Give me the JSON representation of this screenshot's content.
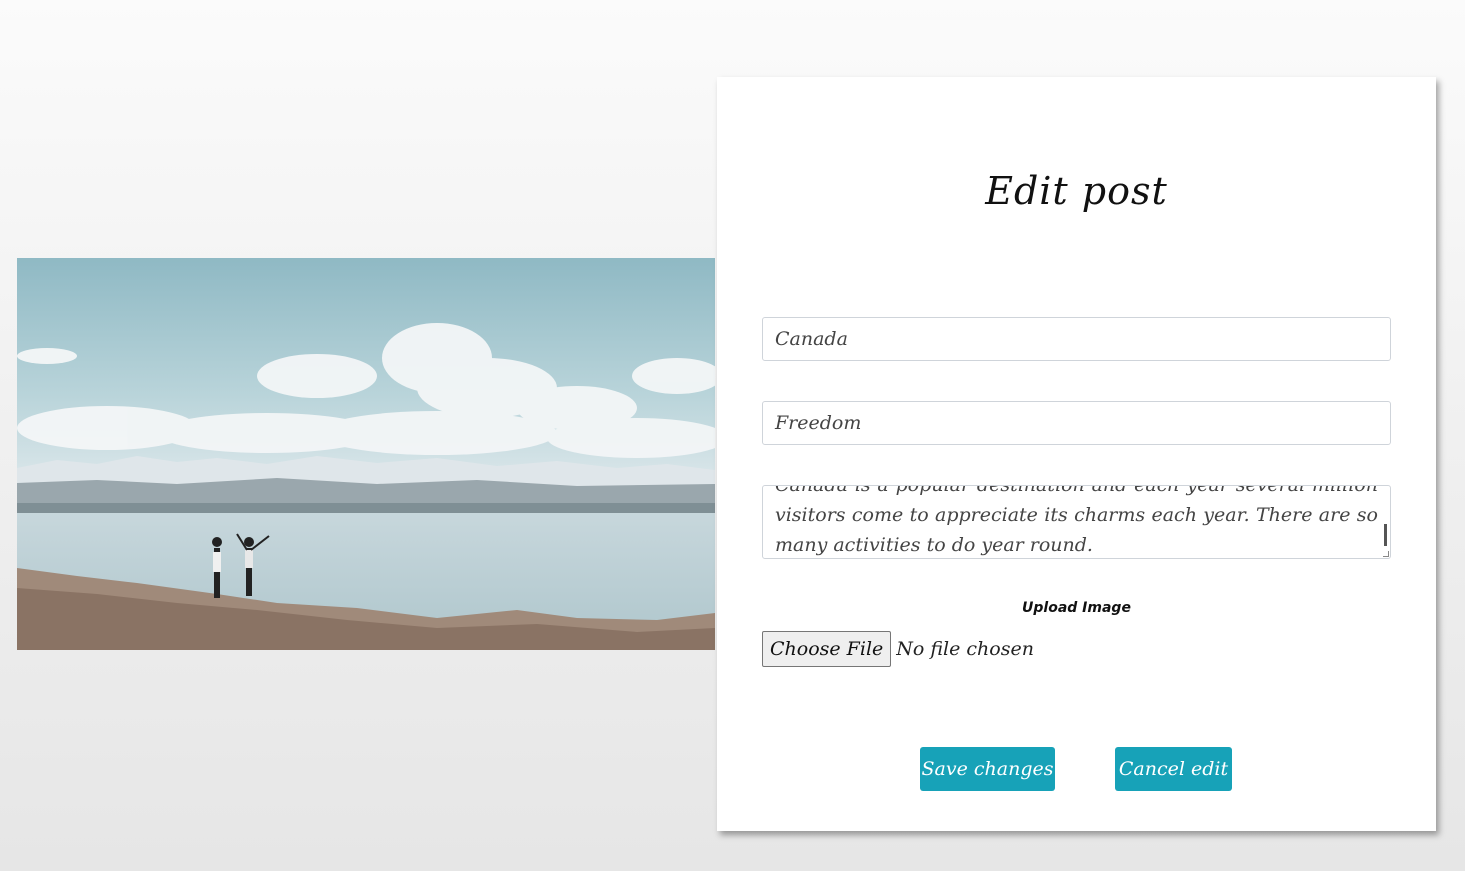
{
  "photo": {
    "description_icon": "landscape-photo"
  },
  "form": {
    "title": "Edit post",
    "fields": {
      "title_value": "Canada",
      "tag_value": "Freedom",
      "body_value": "Canada is a popular destination and each year several million visitors come to appreciate its charms each year. There are so many activities to do year round."
    },
    "upload": {
      "label": "Upload Image",
      "choose_label": "Choose File",
      "status": "No file chosen"
    },
    "buttons": {
      "save": "Save changes",
      "cancel": "Cancel edit"
    }
  },
  "colors": {
    "accent": "#17a2b8"
  }
}
